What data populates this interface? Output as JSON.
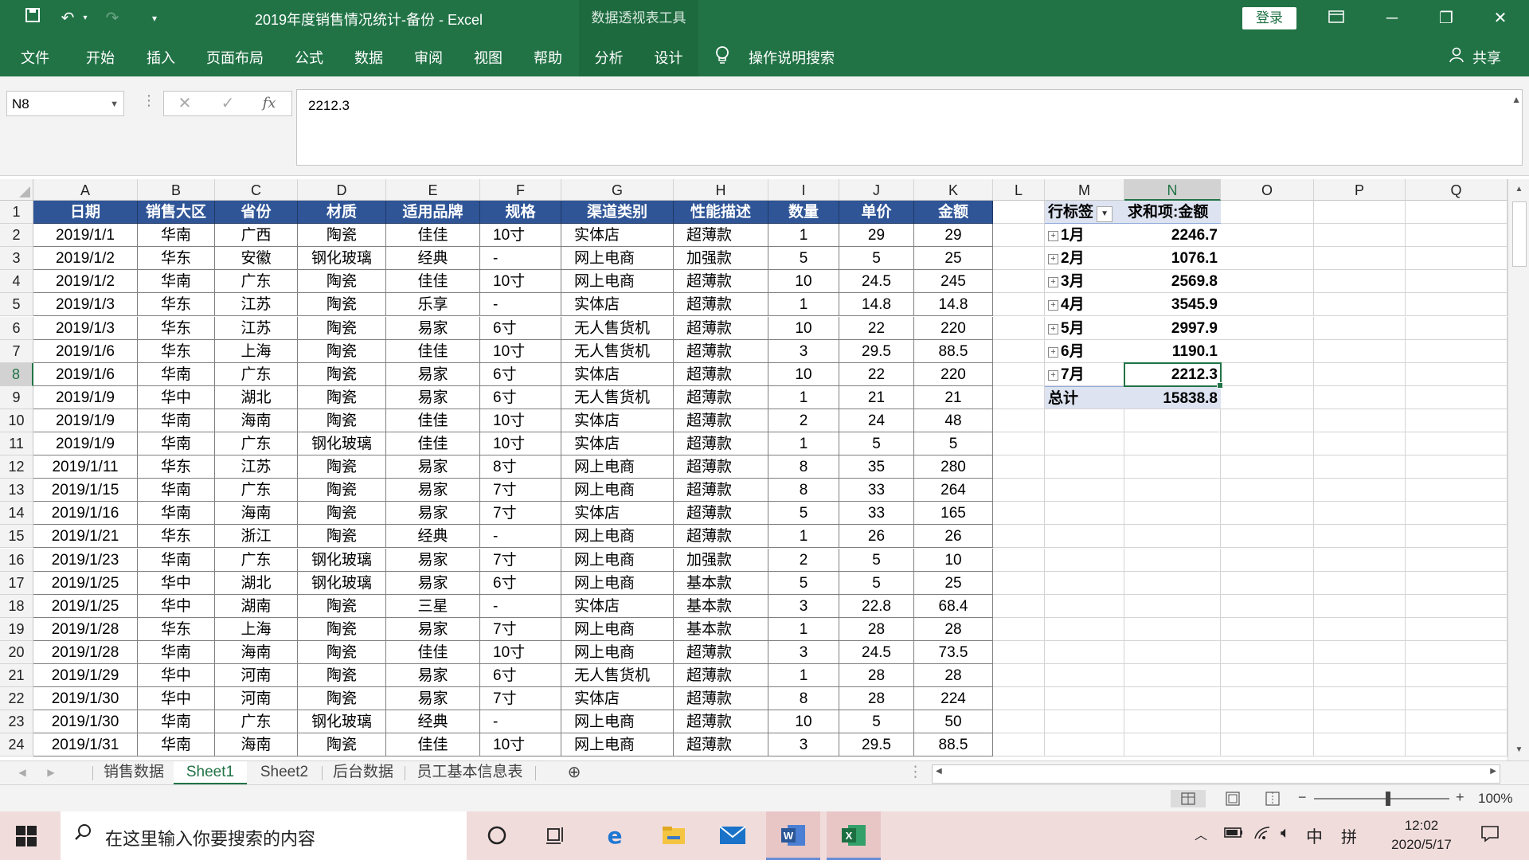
{
  "titlebar": {
    "title": "2019年度销售情况统计-备份  -  Excel",
    "context_title": "数据透视表工具",
    "login": "登录"
  },
  "ribbon": {
    "tabs": [
      "文件",
      "开始",
      "插入",
      "页面布局",
      "公式",
      "数据",
      "审阅",
      "视图",
      "帮助",
      "分析",
      "设计"
    ],
    "tell_me": "操作说明搜索",
    "share": "共享"
  },
  "formula_bar": {
    "name_box": "N8",
    "formula": "2212.3",
    "fx": "fx"
  },
  "columns": [
    "A",
    "B",
    "C",
    "D",
    "E",
    "F",
    "G",
    "H",
    "I",
    "J",
    "K",
    "L",
    "M",
    "N",
    "O",
    "P",
    "Q"
  ],
  "table": {
    "headers": [
      "日期",
      "销售大区",
      "省份",
      "材质",
      "适用品牌",
      "规格",
      "渠道类别",
      "性能描述",
      "数量",
      "单价",
      "金额"
    ],
    "rows": [
      [
        "2019/1/1",
        "华南",
        "广西",
        "陶瓷",
        "佳佳",
        "10寸",
        "实体店",
        "超薄款",
        "1",
        "29",
        "29"
      ],
      [
        "2019/1/2",
        "华东",
        "安徽",
        "钢化玻璃",
        "经典",
        "-",
        "网上电商",
        "加强款",
        "5",
        "5",
        "25"
      ],
      [
        "2019/1/2",
        "华南",
        "广东",
        "陶瓷",
        "佳佳",
        "10寸",
        "网上电商",
        "超薄款",
        "10",
        "24.5",
        "245"
      ],
      [
        "2019/1/3",
        "华东",
        "江苏",
        "陶瓷",
        "乐享",
        "-",
        "实体店",
        "超薄款",
        "1",
        "14.8",
        "14.8"
      ],
      [
        "2019/1/3",
        "华东",
        "江苏",
        "陶瓷",
        "易家",
        "6寸",
        "无人售货机",
        "超薄款",
        "10",
        "22",
        "220"
      ],
      [
        "2019/1/6",
        "华东",
        "上海",
        "陶瓷",
        "佳佳",
        "10寸",
        "无人售货机",
        "超薄款",
        "3",
        "29.5",
        "88.5"
      ],
      [
        "2019/1/6",
        "华南",
        "广东",
        "陶瓷",
        "易家",
        "6寸",
        "实体店",
        "超薄款",
        "10",
        "22",
        "220"
      ],
      [
        "2019/1/9",
        "华中",
        "湖北",
        "陶瓷",
        "易家",
        "6寸",
        "无人售货机",
        "超薄款",
        "1",
        "21",
        "21"
      ],
      [
        "2019/1/9",
        "华南",
        "海南",
        "陶瓷",
        "佳佳",
        "10寸",
        "实体店",
        "超薄款",
        "2",
        "24",
        "48"
      ],
      [
        "2019/1/9",
        "华南",
        "广东",
        "钢化玻璃",
        "佳佳",
        "10寸",
        "实体店",
        "超薄款",
        "1",
        "5",
        "5"
      ],
      [
        "2019/1/11",
        "华东",
        "江苏",
        "陶瓷",
        "易家",
        "8寸",
        "网上电商",
        "超薄款",
        "8",
        "35",
        "280"
      ],
      [
        "2019/1/15",
        "华南",
        "广东",
        "陶瓷",
        "易家",
        "7寸",
        "网上电商",
        "超薄款",
        "8",
        "33",
        "264"
      ],
      [
        "2019/1/16",
        "华南",
        "海南",
        "陶瓷",
        "易家",
        "7寸",
        "实体店",
        "超薄款",
        "5",
        "33",
        "165"
      ],
      [
        "2019/1/21",
        "华东",
        "浙江",
        "陶瓷",
        "经典",
        "-",
        "网上电商",
        "超薄款",
        "1",
        "26",
        "26"
      ],
      [
        "2019/1/23",
        "华南",
        "广东",
        "钢化玻璃",
        "易家",
        "7寸",
        "网上电商",
        "加强款",
        "2",
        "5",
        "10"
      ],
      [
        "2019/1/25",
        "华中",
        "湖北",
        "钢化玻璃",
        "易家",
        "6寸",
        "网上电商",
        "基本款",
        "5",
        "5",
        "25"
      ],
      [
        "2019/1/25",
        "华中",
        "湖南",
        "陶瓷",
        "三星",
        "-",
        "实体店",
        "基本款",
        "3",
        "22.8",
        "68.4"
      ],
      [
        "2019/1/28",
        "华东",
        "上海",
        "陶瓷",
        "易家",
        "7寸",
        "网上电商",
        "基本款",
        "1",
        "28",
        "28"
      ],
      [
        "2019/1/28",
        "华南",
        "海南",
        "陶瓷",
        "佳佳",
        "10寸",
        "网上电商",
        "超薄款",
        "3",
        "24.5",
        "73.5"
      ],
      [
        "2019/1/29",
        "华中",
        "河南",
        "陶瓷",
        "易家",
        "6寸",
        "无人售货机",
        "超薄款",
        "1",
        "28",
        "28"
      ],
      [
        "2019/1/30",
        "华中",
        "河南",
        "陶瓷",
        "易家",
        "7寸",
        "实体店",
        "超薄款",
        "8",
        "28",
        "224"
      ],
      [
        "2019/1/30",
        "华南",
        "广东",
        "钢化玻璃",
        "经典",
        "-",
        "网上电商",
        "超薄款",
        "10",
        "5",
        "50"
      ],
      [
        "2019/1/31",
        "华南",
        "海南",
        "陶瓷",
        "佳佳",
        "10寸",
        "网上电商",
        "超薄款",
        "3",
        "29.5",
        "88.5"
      ]
    ]
  },
  "pivot": {
    "row_label": "行标签",
    "value_label": "求和项:金额",
    "rows": [
      {
        "label": "1月",
        "value": "2246.7"
      },
      {
        "label": "2月",
        "value": "1076.1"
      },
      {
        "label": "3月",
        "value": "2569.8"
      },
      {
        "label": "4月",
        "value": "3545.9"
      },
      {
        "label": "5月",
        "value": "2997.9"
      },
      {
        "label": "6月",
        "value": "1190.1"
      },
      {
        "label": "7月",
        "value": "2212.3"
      }
    ],
    "total_label": "总计",
    "total_value": "15838.8"
  },
  "sheets": [
    "销售数据",
    "Sheet1",
    "Sheet2",
    "后台数据",
    "员工基本信息表"
  ],
  "active_sheet": "Sheet1",
  "status": {
    "zoom": "100%"
  },
  "taskbar": {
    "search_placeholder": "在这里输入你要搜索的内容",
    "time": "12:02",
    "date": "2020/5/17",
    "ime1": "中",
    "ime2": "拼"
  },
  "colors": {
    "excel_green": "#217346",
    "table_header": "#2f5597",
    "pivot_header": "#dde3f0"
  }
}
